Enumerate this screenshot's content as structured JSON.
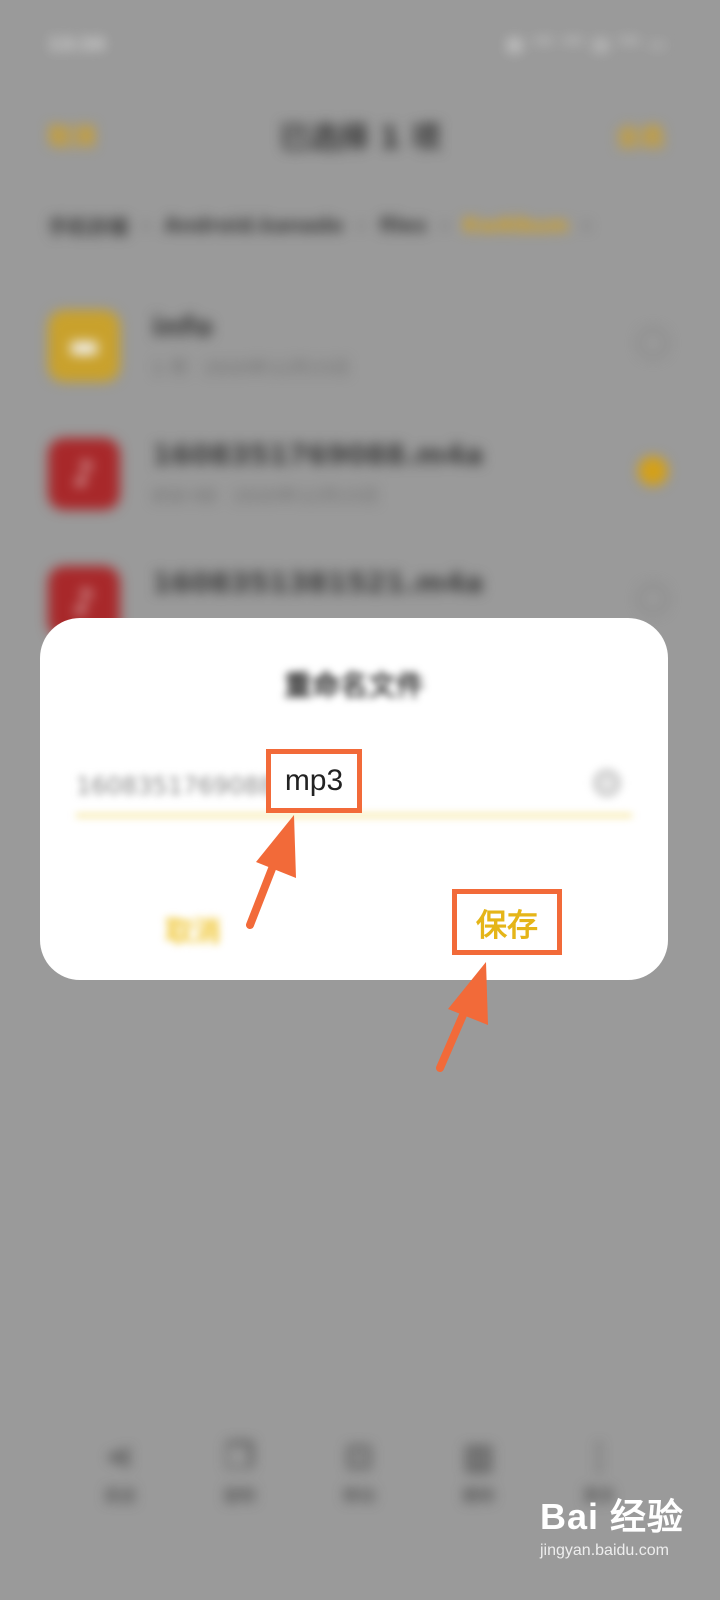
{
  "status_bar": {
    "time": "13:34",
    "indicators": "▦ ⁴ᴳ ⁴ᴳ ▤ ⁵ᴳ ▭"
  },
  "top_bar": {
    "left_label": "取消",
    "title": "已选择 1 项",
    "right_label": "全选"
  },
  "breadcrumb": [
    "手机存储",
    "Android.kanado",
    "files",
    "KwAlbum"
  ],
  "files": [
    {
      "name": "info",
      "meta": "1 项 · 2020年12月15日",
      "icon": "folder-icon",
      "checked": false
    },
    {
      "name": "1608351769088.m4a",
      "meta": "858 KB · 2020年12月15日",
      "icon": "music-note-icon",
      "checked": true
    },
    {
      "name": "1608351381521.m4a",
      "meta": "",
      "icon": "music-note-icon",
      "checked": false
    }
  ],
  "bottom_bar": [
    {
      "label": "发送",
      "icon": "share-icon"
    },
    {
      "label": "复制",
      "icon": "copy-icon"
    },
    {
      "label": "移动",
      "icon": "move-icon"
    },
    {
      "label": "删除",
      "icon": "delete-icon"
    },
    {
      "label": "更多",
      "icon": "more-icon"
    }
  ],
  "dialog": {
    "title": "重命名文件",
    "input_value": "1608351769088",
    "extension_label": "mp3",
    "cancel_label": "取消",
    "save_label": "保存"
  },
  "watermark": {
    "main": "Bai 经验",
    "sub": "jingyan.baidu.com"
  },
  "colors": {
    "accent": "#d4a019",
    "highlight_box": "#f26a39",
    "save_text": "#e5b518"
  }
}
